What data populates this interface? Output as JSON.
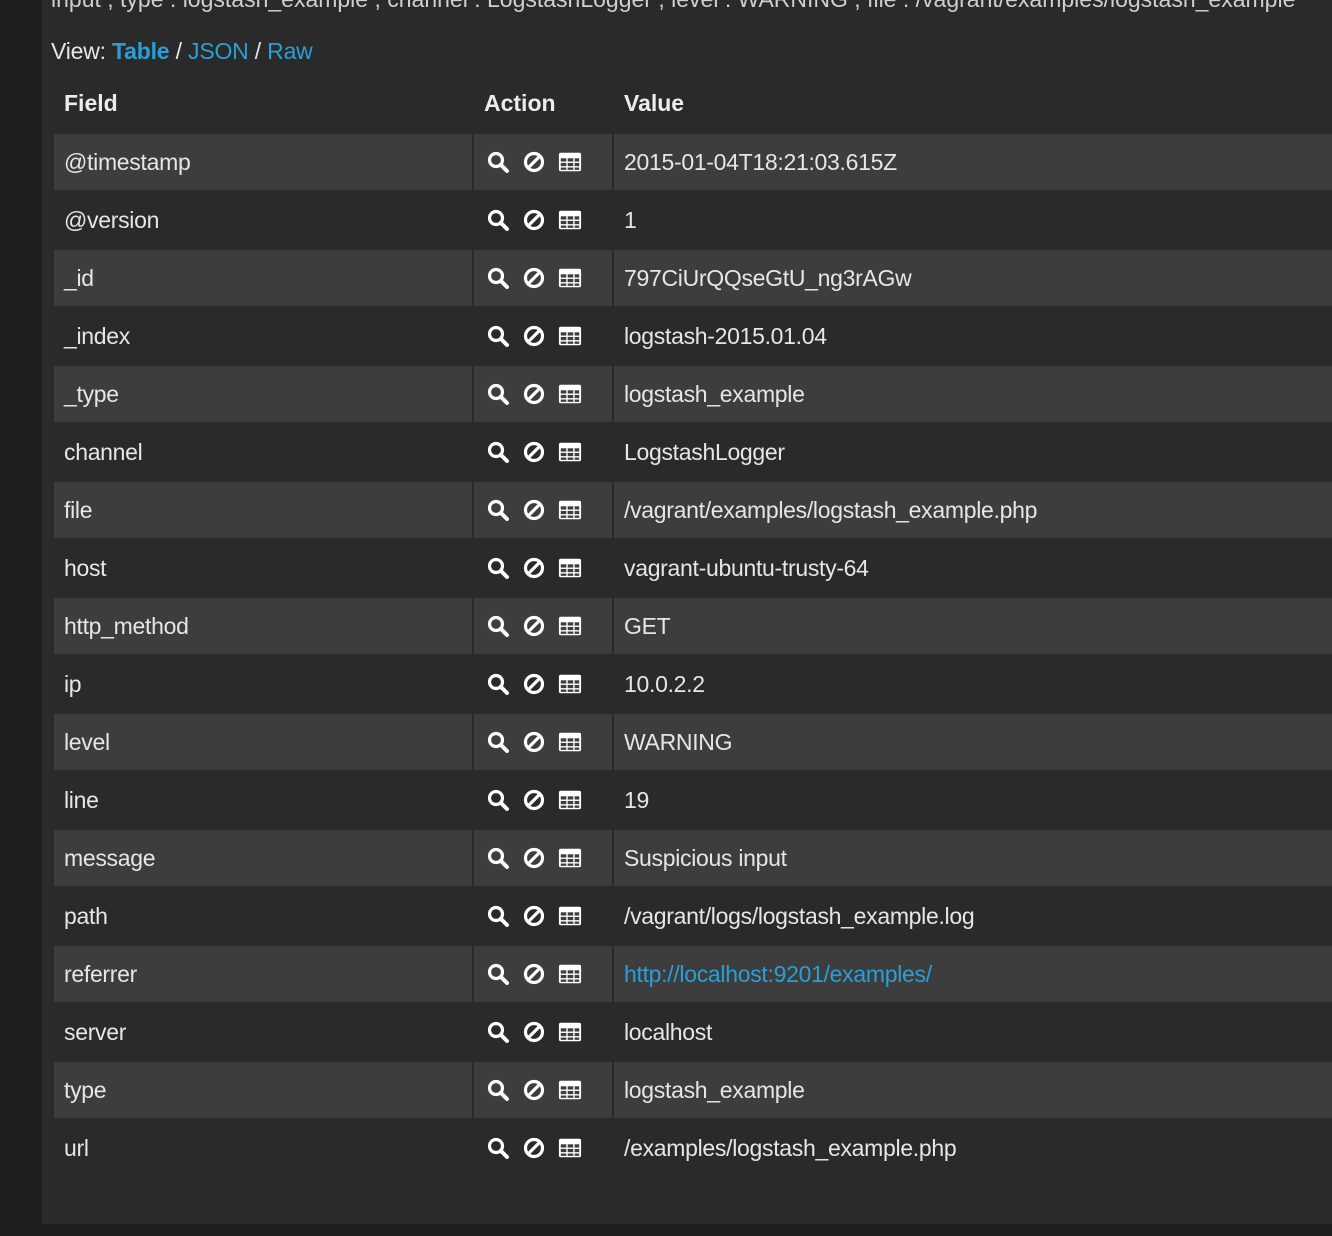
{
  "clipped_summary": "input , type : logstash_example , channel : LogstashLogger , level : WARNING , file : /vagrant/examples/logstash_example",
  "view": {
    "label": "View:",
    "options": [
      {
        "label": "Table",
        "active": true
      },
      {
        "label": "JSON",
        "active": false
      },
      {
        "label": "Raw",
        "active": false
      }
    ],
    "separator": "/"
  },
  "table": {
    "headers": {
      "field": "Field",
      "action": "Action",
      "value": "Value"
    },
    "actions": [
      "filter-for-value-icon",
      "filter-out-value-icon",
      "toggle-column-icon"
    ],
    "rows": [
      {
        "field": "@timestamp",
        "value": "2015-01-04T18:21:03.615Z"
      },
      {
        "field": "@version",
        "value": "1"
      },
      {
        "field": "_id",
        "value": "797CiUrQQseGtU_ng3rAGw"
      },
      {
        "field": "_index",
        "value": "logstash-2015.01.04"
      },
      {
        "field": "_type",
        "value": "logstash_example"
      },
      {
        "field": "channel",
        "value": "LogstashLogger"
      },
      {
        "field": "file",
        "value": "/vagrant/examples/logstash_example.php"
      },
      {
        "field": "host",
        "value": "vagrant-ubuntu-trusty-64"
      },
      {
        "field": "http_method",
        "value": "GET"
      },
      {
        "field": "ip",
        "value": "10.0.2.2"
      },
      {
        "field": "level",
        "value": "WARNING"
      },
      {
        "field": "line",
        "value": "19"
      },
      {
        "field": "message",
        "value": "Suspicious input"
      },
      {
        "field": "path",
        "value": "/vagrant/logs/logstash_example.log"
      },
      {
        "field": "referrer",
        "value": "http://localhost:9201/examples/",
        "is_link": true
      },
      {
        "field": "server",
        "value": "localhost"
      },
      {
        "field": "type",
        "value": "logstash_example"
      },
      {
        "field": "url",
        "value": "/examples/logstash_example.php"
      }
    ]
  },
  "colors": {
    "background": "#1f1f1f",
    "panel": "#2a2a2a",
    "row_stripe": "#3d3d3d",
    "link": "#2a9fd6",
    "text": "#e6e6e6"
  }
}
